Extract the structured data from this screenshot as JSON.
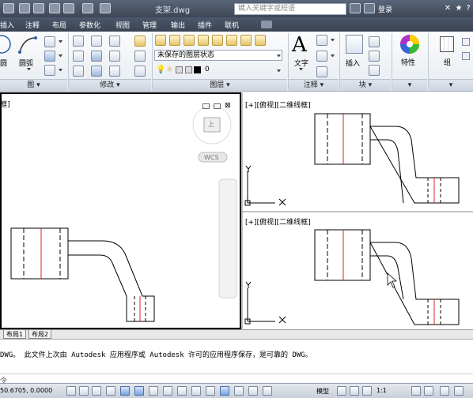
{
  "title_bar": {
    "title": "支架.dwg",
    "search_placeholder": "键入关键字或短语",
    "login_label": "登录"
  },
  "menu": {
    "items": [
      "插入",
      "注释",
      "布局",
      "参数化",
      "视图",
      "管理",
      "输出",
      "插件",
      "联机"
    ]
  },
  "ribbon": {
    "draw_panel": {
      "arc_label": "圆弧",
      "circle_label": "圆",
      "title": "图"
    },
    "modify_panel": {
      "title": "修改"
    },
    "layer_panel": {
      "layer_state": "未保存的图层状态",
      "current_layer": "0",
      "title": "图层"
    },
    "annotation_panel": {
      "text_label": "文字",
      "title": "注释"
    },
    "block_panel": {
      "insert_label": "插入",
      "title": "块"
    },
    "properties_panel": {
      "label": "特性"
    },
    "group_panel": {
      "label": "组"
    }
  },
  "viewports": {
    "left": {
      "label": "框]",
      "wcs": "WCS",
      "viewcube_face": "上"
    },
    "top_right": {
      "label": "[+][俯视][二维线框]"
    },
    "bottom_right": {
      "label": "[+][俯视][二维线框]"
    }
  },
  "tabs": {
    "items": [
      "布局1",
      "布局2"
    ]
  },
  "command": {
    "history": "DWG。  此文件上次由 Autodesk 应用程序或 Autodesk 许可的应用程序保存，是可靠的 DWG。",
    "prompt": "令"
  },
  "status_bar": {
    "coords": "50.6705, 0.0000",
    "model": "模型",
    "scale": "1:1"
  },
  "colors": {
    "title_bg": "#3d4656",
    "accent_red": "#e02020",
    "drawing_bg": "#ffffff"
  }
}
